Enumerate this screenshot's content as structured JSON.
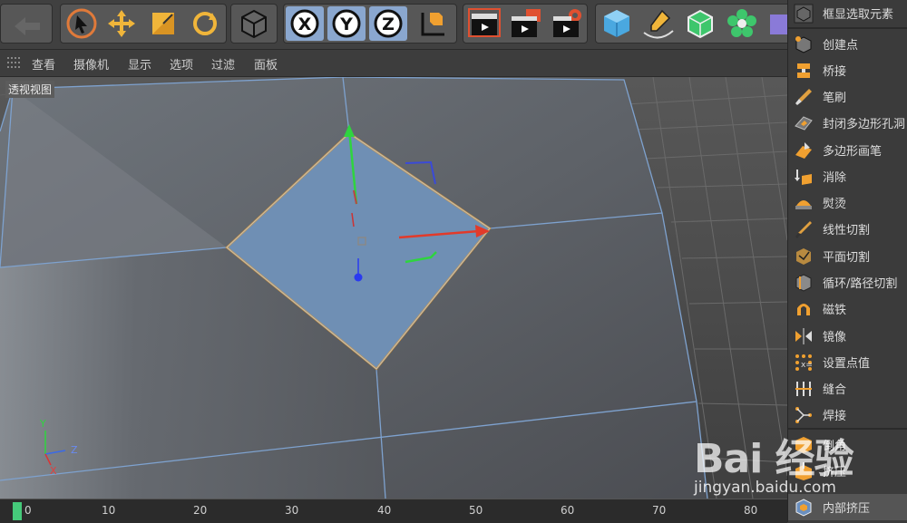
{
  "menu": [
    "查看",
    "摄像机",
    "显示",
    "选项",
    "过滤",
    "面板"
  ],
  "viewport": {
    "label": "透视视图"
  },
  "axis_gizmo": {
    "y": "Y",
    "z": "Z",
    "x": "X"
  },
  "toolbar_axes": [
    "X",
    "Y",
    "Z"
  ],
  "tools": [
    "框显选取元素",
    "创建点",
    "桥接",
    "笔刷",
    "封闭多边形孔洞",
    "多边形画笔",
    "消除",
    "熨烫",
    "线性切割",
    "平面切割",
    "循环/路径切割",
    "磁铁",
    "镜像",
    "设置点值",
    "缝合",
    "焊接",
    "倒角",
    "挤压",
    "内部挤压"
  ],
  "timeline": {
    "ticks": [
      "0",
      "10",
      "20",
      "30",
      "40",
      "50",
      "60",
      "70",
      "80"
    ]
  },
  "watermark": {
    "logo": "Bai 经验",
    "url": "jingyan.baidu.com"
  },
  "colors": {
    "accent": "#e89a2a",
    "selection": "#6f8fb4",
    "axis_button": "#8aa7cf",
    "timeline_handle": "#45c97a"
  }
}
